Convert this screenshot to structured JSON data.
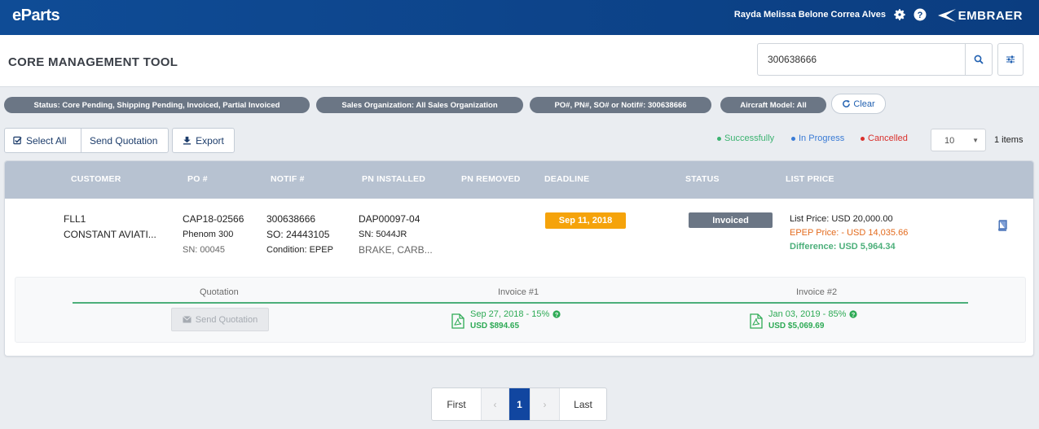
{
  "topbar": {
    "brand": "eParts",
    "user_name": "Rayda Melissa Belone Correa Alves",
    "logo_text": "EMBRAER",
    "icons": [
      "gear-icon",
      "help-icon"
    ]
  },
  "header": {
    "title": "CORE MANAGEMENT TOOL",
    "search_value": "300638666"
  },
  "filters": {
    "chips": [
      "Status: Core Pending, Shipping Pending, Invoiced, Partial Invoiced",
      "Sales Organization: All Sales Organization",
      "PO#, PN#, SO# or Notif#: 300638666",
      "Aircraft Model: All"
    ],
    "clear_label": "Clear"
  },
  "toolbar": {
    "select_all": "Select All",
    "send_quotation": "Send Quotation",
    "export": "Export",
    "legend": [
      {
        "label": "Successfully",
        "color": "#3cb371"
      },
      {
        "label": "In Progress",
        "color": "#3a7bd5"
      },
      {
        "label": "Cancelled",
        "color": "#d9302c"
      }
    ],
    "page_size": "10",
    "items_count": "1 items"
  },
  "table": {
    "headers": [
      "CUSTOMER",
      "PO #",
      "NOTIF #",
      "PN INSTALLED",
      "PN REMOVED",
      "DEADLINE",
      "STATUS",
      "LIST PRICE"
    ],
    "row": {
      "customer_code": "FLL1",
      "customer_name": "CONSTANT AVIATI...",
      "po": "CAP18-02566",
      "aircraft": "Phenom 300",
      "sn": "SN: 00045",
      "notif": "300638666",
      "so": "SO: 24443105",
      "condition": "Condition: EPEP",
      "pn_installed": "DAP00097-04",
      "pn_sn": "SN: 5044JR",
      "pn_desc": "BRAKE, CARB...",
      "deadline": "Sep 11, 2018",
      "status": "Invoiced",
      "list_price": "List Price: USD 20,000.00",
      "epep_price": "EPEP Price: - USD 14,035.66",
      "difference": "Difference: USD 5,964.34",
      "colors": {
        "deadline": "#f5a30b",
        "status": "#6b7685",
        "epep": "#e36b1e",
        "difference": "#4caf7a"
      }
    },
    "detail": {
      "headers": [
        "Quotation",
        "Invoice #1",
        "Invoice #2"
      ],
      "send_quotation": "Send Quotation",
      "invoice1_line1": "Sep 27, 2018 - 15%",
      "invoice1_line2": "USD $894.65",
      "invoice2_line1": "Jan 03, 2019 - 85%",
      "invoice2_line2": "USD $5,069.69"
    }
  },
  "pagination": {
    "first": "First",
    "prev": "‹",
    "current": "1",
    "next": "›",
    "last": "Last"
  }
}
